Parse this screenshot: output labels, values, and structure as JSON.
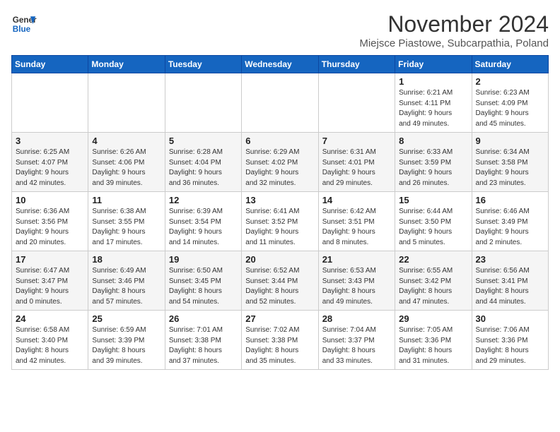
{
  "header": {
    "logo_line1": "General",
    "logo_line2": "Blue",
    "main_title": "November 2024",
    "subtitle": "Miejsce Piastowe, Subcarpathia, Poland"
  },
  "days_of_week": [
    "Sunday",
    "Monday",
    "Tuesday",
    "Wednesday",
    "Thursday",
    "Friday",
    "Saturday"
  ],
  "weeks": [
    [
      {
        "day": "",
        "detail": ""
      },
      {
        "day": "",
        "detail": ""
      },
      {
        "day": "",
        "detail": ""
      },
      {
        "day": "",
        "detail": ""
      },
      {
        "day": "",
        "detail": ""
      },
      {
        "day": "1",
        "detail": "Sunrise: 6:21 AM\nSunset: 4:11 PM\nDaylight: 9 hours\nand 49 minutes."
      },
      {
        "day": "2",
        "detail": "Sunrise: 6:23 AM\nSunset: 4:09 PM\nDaylight: 9 hours\nand 45 minutes."
      }
    ],
    [
      {
        "day": "3",
        "detail": "Sunrise: 6:25 AM\nSunset: 4:07 PM\nDaylight: 9 hours\nand 42 minutes."
      },
      {
        "day": "4",
        "detail": "Sunrise: 6:26 AM\nSunset: 4:06 PM\nDaylight: 9 hours\nand 39 minutes."
      },
      {
        "day": "5",
        "detail": "Sunrise: 6:28 AM\nSunset: 4:04 PM\nDaylight: 9 hours\nand 36 minutes."
      },
      {
        "day": "6",
        "detail": "Sunrise: 6:29 AM\nSunset: 4:02 PM\nDaylight: 9 hours\nand 32 minutes."
      },
      {
        "day": "7",
        "detail": "Sunrise: 6:31 AM\nSunset: 4:01 PM\nDaylight: 9 hours\nand 29 minutes."
      },
      {
        "day": "8",
        "detail": "Sunrise: 6:33 AM\nSunset: 3:59 PM\nDaylight: 9 hours\nand 26 minutes."
      },
      {
        "day": "9",
        "detail": "Sunrise: 6:34 AM\nSunset: 3:58 PM\nDaylight: 9 hours\nand 23 minutes."
      }
    ],
    [
      {
        "day": "10",
        "detail": "Sunrise: 6:36 AM\nSunset: 3:56 PM\nDaylight: 9 hours\nand 20 minutes."
      },
      {
        "day": "11",
        "detail": "Sunrise: 6:38 AM\nSunset: 3:55 PM\nDaylight: 9 hours\nand 17 minutes."
      },
      {
        "day": "12",
        "detail": "Sunrise: 6:39 AM\nSunset: 3:54 PM\nDaylight: 9 hours\nand 14 minutes."
      },
      {
        "day": "13",
        "detail": "Sunrise: 6:41 AM\nSunset: 3:52 PM\nDaylight: 9 hours\nand 11 minutes."
      },
      {
        "day": "14",
        "detail": "Sunrise: 6:42 AM\nSunset: 3:51 PM\nDaylight: 9 hours\nand 8 minutes."
      },
      {
        "day": "15",
        "detail": "Sunrise: 6:44 AM\nSunset: 3:50 PM\nDaylight: 9 hours\nand 5 minutes."
      },
      {
        "day": "16",
        "detail": "Sunrise: 6:46 AM\nSunset: 3:49 PM\nDaylight: 9 hours\nand 2 minutes."
      }
    ],
    [
      {
        "day": "17",
        "detail": "Sunrise: 6:47 AM\nSunset: 3:47 PM\nDaylight: 9 hours\nand 0 minutes."
      },
      {
        "day": "18",
        "detail": "Sunrise: 6:49 AM\nSunset: 3:46 PM\nDaylight: 8 hours\nand 57 minutes."
      },
      {
        "day": "19",
        "detail": "Sunrise: 6:50 AM\nSunset: 3:45 PM\nDaylight: 8 hours\nand 54 minutes."
      },
      {
        "day": "20",
        "detail": "Sunrise: 6:52 AM\nSunset: 3:44 PM\nDaylight: 8 hours\nand 52 minutes."
      },
      {
        "day": "21",
        "detail": "Sunrise: 6:53 AM\nSunset: 3:43 PM\nDaylight: 8 hours\nand 49 minutes."
      },
      {
        "day": "22",
        "detail": "Sunrise: 6:55 AM\nSunset: 3:42 PM\nDaylight: 8 hours\nand 47 minutes."
      },
      {
        "day": "23",
        "detail": "Sunrise: 6:56 AM\nSunset: 3:41 PM\nDaylight: 8 hours\nand 44 minutes."
      }
    ],
    [
      {
        "day": "24",
        "detail": "Sunrise: 6:58 AM\nSunset: 3:40 PM\nDaylight: 8 hours\nand 42 minutes."
      },
      {
        "day": "25",
        "detail": "Sunrise: 6:59 AM\nSunset: 3:39 PM\nDaylight: 8 hours\nand 39 minutes."
      },
      {
        "day": "26",
        "detail": "Sunrise: 7:01 AM\nSunset: 3:38 PM\nDaylight: 8 hours\nand 37 minutes."
      },
      {
        "day": "27",
        "detail": "Sunrise: 7:02 AM\nSunset: 3:38 PM\nDaylight: 8 hours\nand 35 minutes."
      },
      {
        "day": "28",
        "detail": "Sunrise: 7:04 AM\nSunset: 3:37 PM\nDaylight: 8 hours\nand 33 minutes."
      },
      {
        "day": "29",
        "detail": "Sunrise: 7:05 AM\nSunset: 3:36 PM\nDaylight: 8 hours\nand 31 minutes."
      },
      {
        "day": "30",
        "detail": "Sunrise: 7:06 AM\nSunset: 3:36 PM\nDaylight: 8 hours\nand 29 minutes."
      }
    ]
  ]
}
